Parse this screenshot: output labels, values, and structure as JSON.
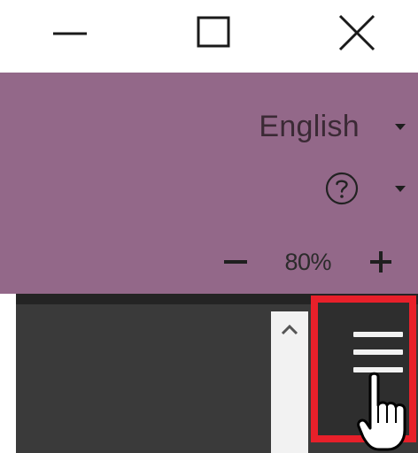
{
  "window_controls": {
    "minimize_icon": "minimize-icon",
    "maximize_icon": "maximize-icon",
    "close_icon": "close-icon"
  },
  "header": {
    "language": {
      "label": "English",
      "icon": "caret-down-icon"
    },
    "help": {
      "icon": "help-circle-icon",
      "dropdown_icon": "caret-down-icon"
    },
    "zoom": {
      "value": "80%",
      "decrease_icon": "minus-icon",
      "increase_icon": "plus-icon"
    }
  },
  "toolbar": {
    "scroll_up_icon": "chevron-up-icon",
    "menu_button_icon": "hamburger-menu-icon",
    "menu_highlighted": true,
    "cursor_icon": "hand-pointer-icon"
  },
  "colors": {
    "header_bg": "#936889",
    "toolbar_bg": "#3a3a3a",
    "highlight": "#e8202a"
  }
}
